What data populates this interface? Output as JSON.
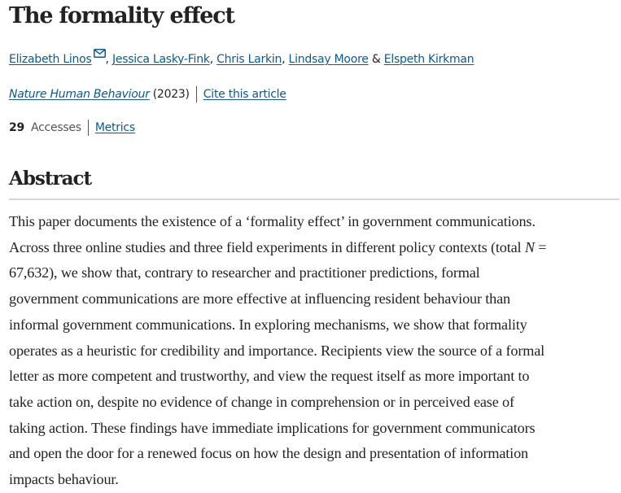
{
  "article": {
    "title": "The formality effect",
    "authors": [
      {
        "name": "Elizabeth Linos",
        "corresponding": true,
        "sep_after": ", "
      },
      {
        "name": "Jessica Lasky-Fink",
        "corresponding": false,
        "sep_after": ", "
      },
      {
        "name": "Chris Larkin",
        "corresponding": false,
        "sep_after": ", "
      },
      {
        "name": "Lindsay Moore",
        "corresponding": false,
        "sep_after": " & "
      },
      {
        "name": "Elspeth Kirkman",
        "corresponding": false,
        "sep_after": ""
      }
    ],
    "mail_icon": "envelope-icon",
    "journal": "Nature Human Behaviour",
    "year": "(2023)",
    "cite_label": "Cite this article",
    "accesses_count": "29",
    "accesses_label": "Accesses",
    "metrics_label": "Metrics"
  },
  "abstract": {
    "heading": "Abstract",
    "lines": [
      "This paper documents the existence of a ‘formality effect’ in government communications.",
      "Across three online studies and three field experiments in different policy contexts (total ",
      "67,632), we show that, contrary to researcher and practitioner predictions, formal",
      "government communications are more effective at influencing resident behaviour than",
      "informal government communications. In exploring mechanisms, we show that formality",
      "operates as a heuristic for credibility and importance. Recipients view the source of a formal",
      "letter as more competent and trustworthy, and view the request itself as more important to",
      "take action on, despite no evidence of change in comprehension or in perceived ease of",
      "taking action. These findings have immediate implications for government communicators",
      "and open the door for a renewed focus on how the design and presentation of information",
      "impacts behaviour."
    ],
    "line2_italic": "N",
    "line2_tail": " ="
  },
  "colors": {
    "link": "#0c5a8a",
    "text": "#222222",
    "rule": "#d5d5d5"
  }
}
